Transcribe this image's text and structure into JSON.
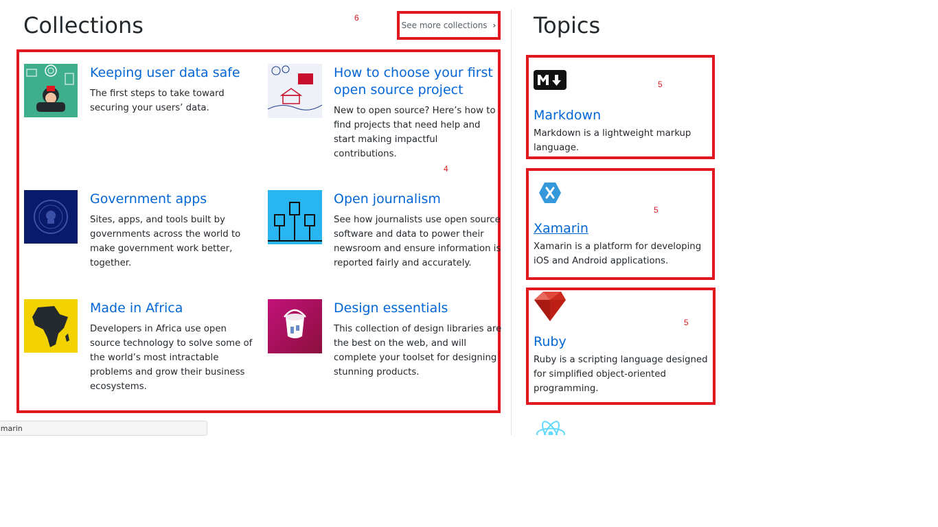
{
  "collections": {
    "heading": "Collections",
    "see_more_label": "See more collections",
    "see_more_icon": "chevron-right-icon",
    "items": [
      {
        "title": "Keeping user data safe",
        "description_lines": [
          "The first steps to take toward",
          "securing your users’ data."
        ],
        "image": "security-octocat-illustration"
      },
      {
        "title": "How to choose your first open source project",
        "title_lines": [
          "How to choose your first",
          "open source project"
        ],
        "description_lines": [
          "New to open source? Here’s how to",
          "find projects that need help and",
          "start making impactful",
          "contributions."
        ],
        "image": "house-map-illustration"
      },
      {
        "title": "Government apps",
        "description_lines": [
          "Sites, apps, and tools built by",
          "governments across the world to",
          "make government work better,",
          "together."
        ],
        "image": "government-seal-illustration"
      },
      {
        "title": "Open journalism",
        "description_lines": [
          "See how journalists use open source",
          "software and data to power their",
          "newsroom and ensure information is",
          "reported fairly and accurately."
        ],
        "image": "raised-fists-illustration"
      },
      {
        "title": "Made in Africa",
        "description_lines": [
          "Developers in Africa use open",
          "source technology to solve some of",
          "the world’s most intractable",
          "problems and grow their business",
          "ecosystems."
        ],
        "image": "africa-map-illustration"
      },
      {
        "title": "Design essentials",
        "description_lines": [
          "This collection of design libraries are",
          "the best on the web, and will",
          "complete your toolset for designing",
          "stunning products."
        ],
        "image": "paint-bucket-illustration"
      }
    ]
  },
  "topics": {
    "heading": "Topics",
    "items": [
      {
        "title": "Markdown",
        "description_lines": [
          "Markdown is a lightweight markup",
          "language."
        ],
        "icon": "markdown-logo-icon"
      },
      {
        "title": "Xamarin",
        "description_lines": [
          "Xamarin is a platform for developing",
          "iOS and Android applications."
        ],
        "icon": "xamarin-logo-icon"
      },
      {
        "title": "Ruby",
        "description_lines": [
          "Ruby is a scripting language designed",
          "for simplified object-oriented",
          "programming."
        ],
        "icon": "ruby-gem-icon"
      }
    ],
    "partial_icon": "react-logo-icon"
  },
  "annotations": {
    "see_more": "6",
    "collections_grid": "4",
    "topic_markdown": "5",
    "topic_xamarin": "5",
    "topic_ruby": "5"
  },
  "status_tab": {
    "text": "amarin"
  },
  "colors": {
    "link": "#0366d6",
    "annotation_red": "#e1181f",
    "text": "#24292e",
    "divider": "#e1e4e8"
  }
}
